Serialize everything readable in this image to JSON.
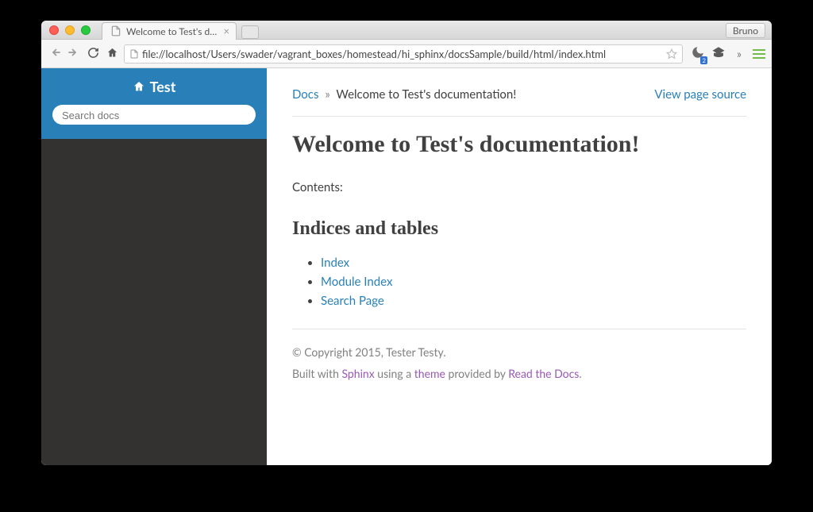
{
  "browser": {
    "profile_name": "Bruno",
    "tab_title": "Welcome to Test's docume",
    "url": "file://localhost/Users/swader/vagrant_boxes/homestead/hi_sphinx/docsSample/build/html/index.html",
    "badge_count": "2"
  },
  "sidebar": {
    "title": "Test",
    "search_placeholder": "Search docs"
  },
  "breadcrumbs": {
    "root": "Docs",
    "separator": "»",
    "current": "Welcome to Test's documentation!",
    "view_source": "View page source"
  },
  "content": {
    "h1": "Welcome to Test's documentation!",
    "contents_label": "Contents:",
    "h2": "Indices and tables",
    "links": [
      "Index",
      "Module Index",
      "Search Page"
    ]
  },
  "footer": {
    "copyright": "© Copyright 2015, Tester Testy.",
    "built_prefix": "Built with ",
    "sphinx": "Sphinx",
    "using_a": " using a ",
    "theme": "theme",
    "provided_by": " provided by ",
    "rtd": "Read the Docs",
    "period": "."
  }
}
